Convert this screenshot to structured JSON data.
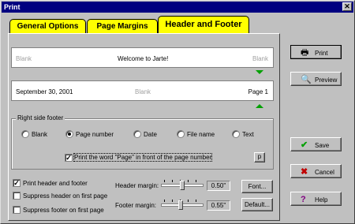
{
  "window": {
    "title": "Print",
    "close_glyph": "✕"
  },
  "tabs": [
    {
      "label": "General Options",
      "active": false
    },
    {
      "label": "Page Margins",
      "active": false
    },
    {
      "label": "Header and Footer",
      "active": true
    }
  ],
  "header_preview": {
    "left": "Blank",
    "center": "Welcome to Jarte!",
    "right": "Blank"
  },
  "footer_preview": {
    "left": "September 30, 2001",
    "center": "Blank",
    "right": "Page 1"
  },
  "footer_group": {
    "title": "Right side footer",
    "options": [
      {
        "label": "Blank",
        "checked": false
      },
      {
        "label": "Page number",
        "checked": true
      },
      {
        "label": "Date",
        "checked": false
      },
      {
        "label": "File name",
        "checked": false
      },
      {
        "label": "Text",
        "checked": false
      }
    ],
    "page_word_label": "Print the word \"Page\" in front of the page number",
    "page_word_checked": true,
    "small_button_label": "p"
  },
  "options": {
    "print_header_footer": {
      "label": "Print header and footer",
      "checked": true
    },
    "suppress_header": {
      "label": "Suppress header on first page",
      "checked": false
    },
    "suppress_footer": {
      "label": "Suppress footer on first page",
      "checked": false
    }
  },
  "margins": {
    "header": {
      "label": "Header margin:",
      "value": "0.50\""
    },
    "footer": {
      "label": "Footer margin:",
      "value": "0.55\""
    }
  },
  "buttons": {
    "font": "Font...",
    "default": "Default...",
    "print": "Print",
    "preview": "Preview",
    "save": "Save",
    "cancel": "Cancel",
    "help": "Help"
  },
  "colors": {
    "tab_yellow": "#ffff00",
    "arrow_green": "#00a000",
    "title_blue": "#000080"
  }
}
